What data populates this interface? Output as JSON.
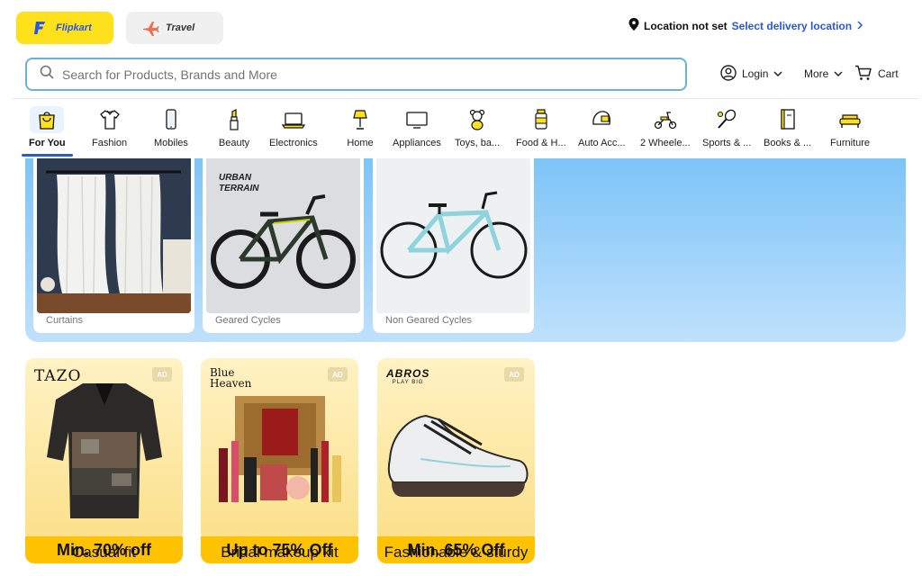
{
  "header": {
    "tabs": [
      {
        "label": "Flipkart",
        "icon": "flipkart-logo-icon"
      },
      {
        "label": "Travel",
        "icon": "airplane-icon"
      }
    ],
    "location": {
      "text": "Location not set",
      "link": "Select delivery location",
      "icon": "location-pin-icon"
    },
    "search": {
      "placeholder": "Search for Products, Brands and More",
      "icon": "search-icon"
    },
    "login_label": "Login",
    "more_label": "More",
    "cart_label": "Cart"
  },
  "categories": [
    {
      "label": "For You",
      "icon": "shopping-bag-icon",
      "active": true
    },
    {
      "label": "Fashion",
      "icon": "tshirt-icon"
    },
    {
      "label": "Mobiles",
      "icon": "mobile-phone-icon"
    },
    {
      "label": "Beauty",
      "icon": "lipstick-icon"
    },
    {
      "label": "Electronics",
      "icon": "laptop-icon"
    },
    {
      "label": "Home",
      "icon": "lamp-icon"
    },
    {
      "label": "Appliances",
      "icon": "tv-icon"
    },
    {
      "label": "Toys, ba...",
      "icon": "teddy-bear-icon"
    },
    {
      "label": "Food & H...",
      "icon": "jar-icon"
    },
    {
      "label": "Auto Acc...",
      "icon": "helmet-icon"
    },
    {
      "label": "2 Wheele...",
      "icon": "scooter-icon"
    },
    {
      "label": "Sports & ...",
      "icon": "racket-icon"
    },
    {
      "label": "Books & ...",
      "icon": "book-icon"
    },
    {
      "label": "Furniture",
      "icon": "sofa-icon"
    }
  ],
  "banner_products": [
    {
      "label": "Curtains"
    },
    {
      "label": "Geared Cycles",
      "brand_text": "URBAN TERRAIN"
    },
    {
      "label": "Non Geared Cycles"
    }
  ],
  "ads": [
    {
      "badge": "AD",
      "brand": "TAZO",
      "offer": "Min. 70% off",
      "name": "Casual fit"
    },
    {
      "badge": "AD",
      "brand": "Blue Heaven",
      "offer": "Up to 75% Off",
      "name": "Bridal makeup kit"
    },
    {
      "badge": "AD",
      "brand": "ABROS",
      "brand_sub": "PLAY BIG",
      "offer": "Min. 65% Off",
      "name": "Fashionable & sturdy"
    }
  ],
  "colors": {
    "accent": "#2a55e5",
    "flipkart_yellow": "#FFE11B",
    "offer_yellow": "#FFC200",
    "banner_blue": "#7DC4F7"
  }
}
